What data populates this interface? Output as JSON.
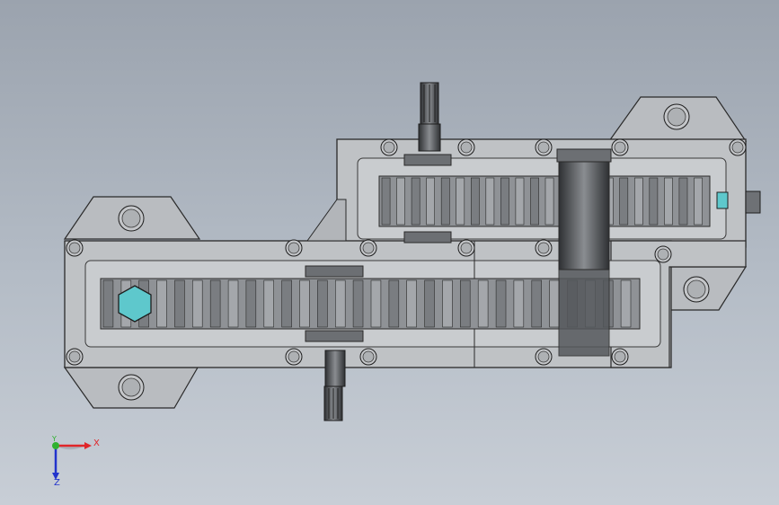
{
  "viewport": {
    "background_top": "#9ba3ae",
    "background_bottom": "#c8ced6"
  },
  "model": {
    "housing_color": "#b9bcc0",
    "housing_edge": "#2a2a2a",
    "gear_color": "#8f9296",
    "gear_dark": "#4a4d51",
    "drain_plug_color": "#5ec8cc",
    "upper_gear_teeth": 22,
    "lower_gear_teeth": 30
  },
  "triad": {
    "x_label": "X",
    "y_label": "Y",
    "z_label": "Z",
    "x_color": "#e0262a",
    "y_color": "#2fb12f",
    "z_color": "#2233cc"
  }
}
